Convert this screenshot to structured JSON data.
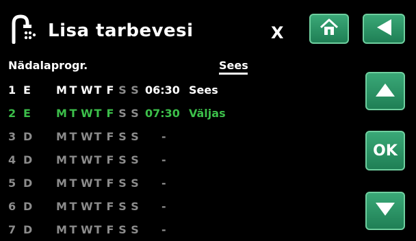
{
  "header": {
    "title": "Lisa tarbevesi",
    "close_label": "X"
  },
  "buttons": {
    "ok_label": "OK"
  },
  "program": {
    "label": "Nädalaprogr.",
    "status_header": "Sees",
    "rows": [
      {
        "idx": "1",
        "mode": "E",
        "days": [
          "M",
          "T",
          "W",
          "T",
          "F",
          "S",
          "S"
        ],
        "time": "06:30",
        "status": "Sees"
      },
      {
        "idx": "2",
        "mode": "E",
        "days": [
          "M",
          "T",
          "W",
          "T",
          "F",
          "S",
          "S"
        ],
        "time": "07:30",
        "status": "Väljas"
      },
      {
        "idx": "3",
        "mode": "D",
        "days": [
          "M",
          "T",
          "W",
          "T",
          "F",
          "S",
          "S"
        ],
        "time": "-",
        "status": ""
      },
      {
        "idx": "4",
        "mode": "D",
        "days": [
          "M",
          "T",
          "W",
          "T",
          "F",
          "S",
          "S"
        ],
        "time": "-",
        "status": ""
      },
      {
        "idx": "5",
        "mode": "D",
        "days": [
          "M",
          "T",
          "W",
          "T",
          "F",
          "S",
          "S"
        ],
        "time": "-",
        "status": ""
      },
      {
        "idx": "6",
        "mode": "D",
        "days": [
          "M",
          "T",
          "W",
          "T",
          "F",
          "S",
          "S"
        ],
        "time": "-",
        "status": ""
      },
      {
        "idx": "7",
        "mode": "D",
        "days": [
          "M",
          "T",
          "W",
          "T",
          "F",
          "S",
          "S"
        ],
        "time": "-",
        "status": ""
      }
    ]
  },
  "colors": {
    "accent": "#2e9a68",
    "selected": "#3cbf4a",
    "inactive": "#8c8c8c"
  }
}
